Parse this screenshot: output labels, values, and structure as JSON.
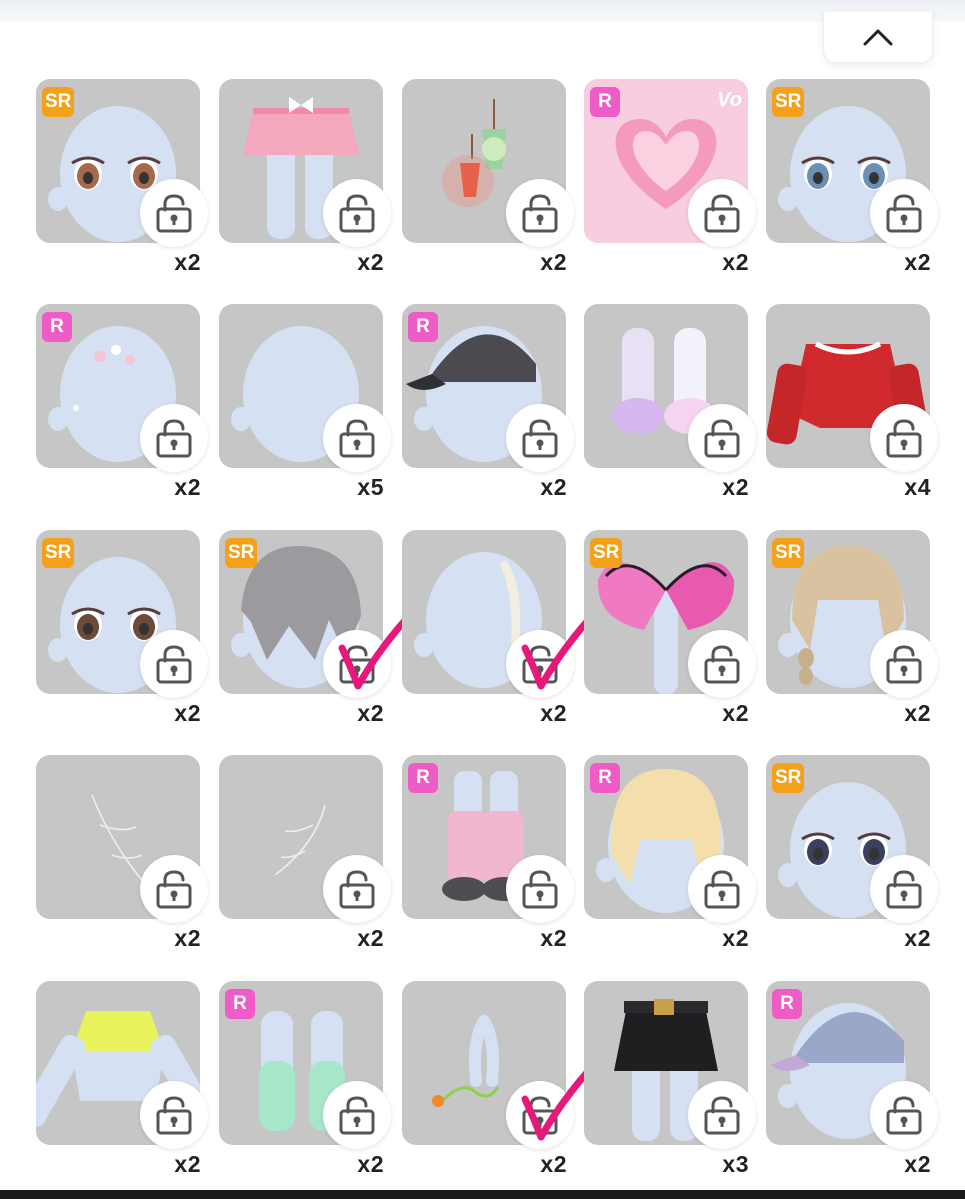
{
  "header": {
    "collapse_icon": "chevron-up-icon"
  },
  "colors": {
    "sr_badge": "#f4a018",
    "r_badge": "#ef5cc8",
    "tile_bg": "#c6c6c6",
    "check_mark": "#e8177a"
  },
  "items": [
    {
      "badge": "SR",
      "count": "x2",
      "art": "face-brown-eyes",
      "checked": false
    },
    {
      "badge": "",
      "count": "x2",
      "art": "pink-skirt",
      "checked": false
    },
    {
      "badge": "",
      "count": "x2",
      "art": "lanterns",
      "checked": false
    },
    {
      "badge": "R",
      "count": "x2",
      "art": "heart-card",
      "vo": "Vo",
      "checked": false
    },
    {
      "badge": "SR",
      "count": "x2",
      "art": "face-blue-eyes",
      "checked": false
    },
    {
      "badge": "R",
      "count": "x2",
      "art": "flower-head",
      "checked": false
    },
    {
      "badge": "",
      "count": "x5",
      "art": "plain-head",
      "checked": false
    },
    {
      "badge": "R",
      "count": "x2",
      "art": "black-cap",
      "checked": false
    },
    {
      "badge": "",
      "count": "x2",
      "art": "slippers",
      "checked": false
    },
    {
      "badge": "",
      "count": "x4",
      "art": "red-jacket",
      "checked": false
    },
    {
      "badge": "SR",
      "count": "x2",
      "art": "face-dark-eyes",
      "checked": false
    },
    {
      "badge": "SR",
      "count": "x2",
      "art": "grey-hair",
      "checked": true
    },
    {
      "badge": "",
      "count": "x2",
      "art": "hair-streak",
      "checked": true
    },
    {
      "badge": "SR",
      "count": "x2",
      "art": "butterfly-wings",
      "checked": false
    },
    {
      "badge": "SR",
      "count": "x2",
      "art": "blonde-braid-hair",
      "checked": false
    },
    {
      "badge": "",
      "count": "x2",
      "art": "web-left",
      "checked": false
    },
    {
      "badge": "",
      "count": "x2",
      "art": "web-right",
      "checked": false
    },
    {
      "badge": "R",
      "count": "x2",
      "art": "leg-warmers",
      "checked": false
    },
    {
      "badge": "R",
      "count": "x2",
      "art": "blonde-short-hair",
      "checked": false
    },
    {
      "badge": "SR",
      "count": "x2",
      "art": "face-lashes",
      "checked": false
    },
    {
      "badge": "",
      "count": "x2",
      "art": "neon-top",
      "checked": false
    },
    {
      "badge": "R",
      "count": "x2",
      "art": "mint-socks",
      "checked": false
    },
    {
      "badge": "",
      "count": "x2",
      "art": "cable-accessory",
      "checked": true
    },
    {
      "badge": "",
      "count": "x3",
      "art": "black-skirt",
      "checked": false
    },
    {
      "badge": "R",
      "count": "x2",
      "art": "denim-cap",
      "checked": false
    }
  ]
}
